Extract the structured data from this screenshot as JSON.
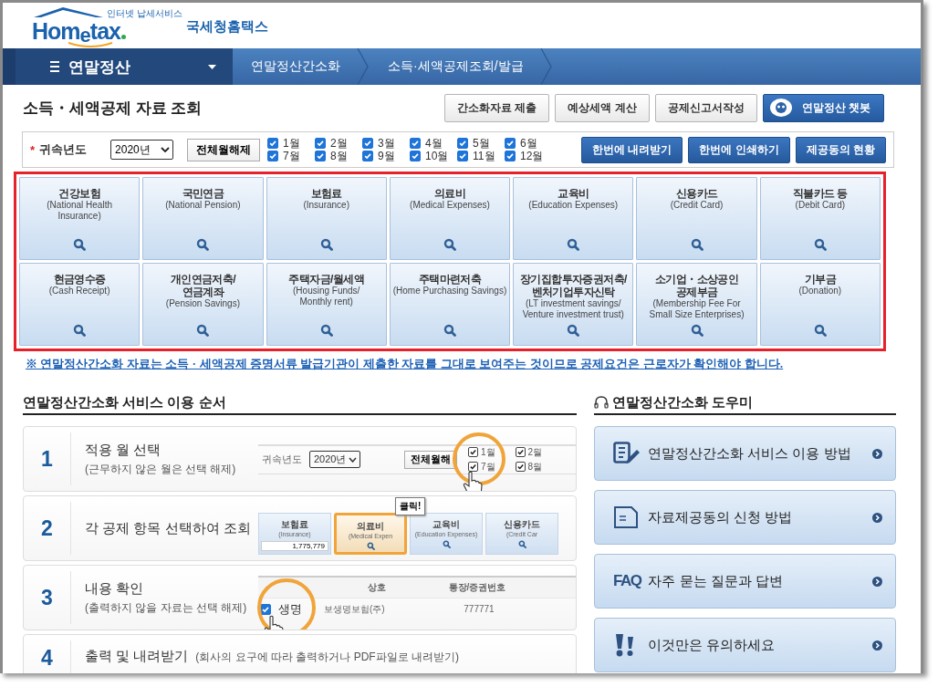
{
  "logo": {
    "tagline": "인터넷 납세서비스",
    "wordmark": "Hom$_{e}$tax",
    "name": "국세청홈택스"
  },
  "nav": {
    "menu": "연말정산",
    "breadcrumbs": [
      "연말정산간소화",
      "소득·세액공제조회/발급"
    ]
  },
  "page_title": "소득・세액공제 자료 조회",
  "header_buttons": [
    {
      "label": "간소화자료 제출",
      "kind": "plain"
    },
    {
      "label": "예상세액 계산",
      "kind": "plain"
    },
    {
      "label": "공제신고서작성",
      "kind": "plain"
    },
    {
      "label": "연말정산 챗봇",
      "kind": "chatbot"
    }
  ],
  "filter": {
    "required_mark": "*",
    "label": "귀속년도",
    "year": "2020년",
    "clear_button": "전체월해제",
    "months": [
      {
        "label": "1월",
        "checked": true
      },
      {
        "label": "2월",
        "checked": true
      },
      {
        "label": "3월",
        "checked": true
      },
      {
        "label": "4월",
        "checked": true
      },
      {
        "label": "5월",
        "checked": true
      },
      {
        "label": "6월",
        "checked": true
      },
      {
        "label": "7월",
        "checked": true
      },
      {
        "label": "8월",
        "checked": true
      },
      {
        "label": "9월",
        "checked": true
      },
      {
        "label": "10월",
        "checked": true
      },
      {
        "label": "11월",
        "checked": true
      },
      {
        "label": "12월",
        "checked": true
      }
    ],
    "actions": [
      "한번에 내려받기",
      "한번에 인쇄하기",
      "제공동의 현황"
    ]
  },
  "categories": [
    {
      "title": "건강보험",
      "subtitle": "(National Health\nInsurance)"
    },
    {
      "title": "국민연금",
      "subtitle": "(National Pension)"
    },
    {
      "title": "보험료",
      "subtitle": "(Insurance)"
    },
    {
      "title": "의료비",
      "subtitle": "(Medical Expenses)"
    },
    {
      "title": "교육비",
      "subtitle": "(Education Expenses)"
    },
    {
      "title": "신용카드",
      "subtitle": "(Credit Card)"
    },
    {
      "title": "직불카드 등",
      "subtitle": "(Debit Card)"
    },
    {
      "title": "현금영수증",
      "subtitle": "(Cash Receipt)"
    },
    {
      "title": "개인연금저축/\n연금계좌",
      "subtitle": "(Pension Savings)"
    },
    {
      "title": "주택자금/월세액",
      "subtitle": "(Housing Funds/\nMonthly rent)"
    },
    {
      "title": "주택마련저축",
      "subtitle": "(Home Purchasing Savings)"
    },
    {
      "title": "장기집합투자증권저축/\n벤처기업투자신탁",
      "subtitle": "(LT investment savings/\nVenture investment trust)"
    },
    {
      "title": "소기업・소상공인\n공제부금",
      "subtitle": "(Membership Fee For\nSmall Size Enterprises)"
    },
    {
      "title": "기부금",
      "subtitle": "(Donation)"
    }
  ],
  "notice": "※ 연말정산간소화 자료는 소득 · 세액공제 증명서류 발급기관이 제출한 자료를 그대로 보여주는 것이므로 공제요건은 근로자가 확인해야 합니다.",
  "steps_section": {
    "title": "연말정산간소화 서비스 이용 순서",
    "steps": [
      {
        "number": "1",
        "title": "적용 월 선택",
        "subtitle": "(근무하지 않은 월은 선택 해제)",
        "kind": "months",
        "demo": {
          "label": "귀속년도",
          "year": "2020년",
          "button": "전체월해",
          "months": [
            {
              "label": "1월",
              "checked": true
            },
            {
              "label": "7월",
              "checked": true
            },
            {
              "label": "2월",
              "checked": true
            },
            {
              "label": "8월",
              "checked": true
            }
          ]
        }
      },
      {
        "number": "2",
        "title": "각 공제 항목 선택하여 조회",
        "kind": "tiles",
        "demo": {
          "callout": "클릭!",
          "tiles": [
            {
              "title": "보험료",
              "subtitle": "(Insurance)",
              "amount": "1,775,779",
              "highlighted": false
            },
            {
              "title": "의료비",
              "subtitle": "(Medical Expen",
              "highlighted": true
            },
            {
              "title": "교육비",
              "subtitle": "(Education Expenses)",
              "highlighted": false
            },
            {
              "title": "신용카드",
              "subtitle": "(Credit Car",
              "highlighted": false
            }
          ]
        }
      },
      {
        "number": "3",
        "title": "내용 확인",
        "subtitle": "(출력하지 않을 자료는 선택 해제)",
        "kind": "table",
        "demo": {
          "columns": [
            "상호",
            "통장/증권번호"
          ],
          "rows": [
            {
              "checked": true,
              "magnified": "생명",
              "company": "보생명보험(주)",
              "account": "777771"
            }
          ]
        }
      },
      {
        "number": "4",
        "title": "출력 및 내려받기",
        "subtitle": "(회사의 요구에 따라 출력하거나 PDF파일로 내려받기)",
        "kind": "inline"
      }
    ]
  },
  "helper": {
    "title": "연말정산간소화 도우미",
    "items": [
      {
        "label": "연말정산간소화 서비스 이용 방법",
        "kind": "guide"
      },
      {
        "label": "자료제공동의 신청 방법",
        "kind": "document"
      },
      {
        "label": "자주 묻는 질문과 답변",
        "kind": "faq",
        "badge": "FAQ"
      },
      {
        "label": "이것만은 유의하세요",
        "kind": "caution"
      }
    ]
  }
}
